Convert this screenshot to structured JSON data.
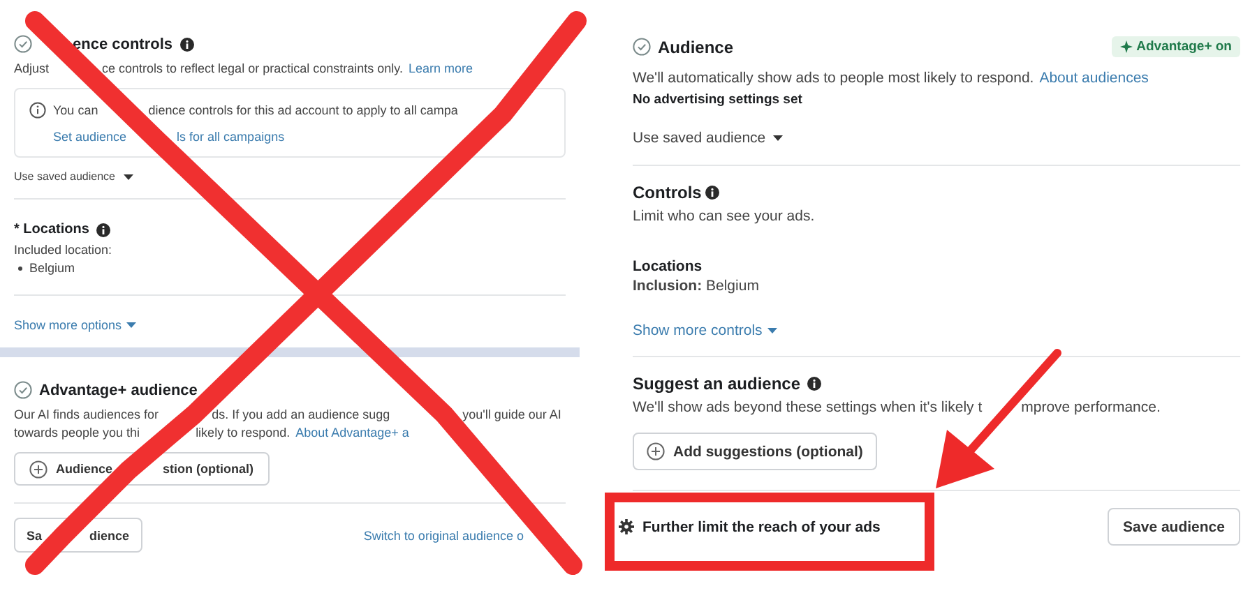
{
  "old_panel": {
    "audience_controls": {
      "title": "ence controls",
      "description": [
        "Adjust",
        "ce controls to reflect legal or practical constraints only."
      ],
      "link": "Learn more",
      "notice": {
        "text": [
          "You can",
          "dience controls for this ad account to apply to all campa"
        ],
        "link": [
          "Set audience",
          "ls for all campaigns"
        ]
      },
      "saved_audience": "Use saved audience"
    },
    "locations": {
      "label": "* Locations",
      "sublabel": "Included location:",
      "items": [
        "Belgium"
      ]
    },
    "show_more": "Show more options",
    "advantage": {
      "title": "Advantage+ audience",
      "lines": [
        [
          "Our AI finds audiences for",
          "ds. If you add an audience sugg",
          "you'll guide our AI"
        ],
        [
          "towards people you thi",
          "likely to respond."
        ]
      ],
      "link": "About Advantage+ a",
      "button": [
        "Audience",
        "stion (optional)"
      ]
    },
    "footer": {
      "save_button": [
        "Sa",
        "dience"
      ],
      "link": "Switch to original audience o"
    }
  },
  "new_panel": {
    "audience": {
      "title": "Audience",
      "badge": "Advantage+ on",
      "description": "We'll automatically show ads to people most likely to respond.",
      "link": "About audiences",
      "note": "No advertising settings set",
      "saved_audience": "Use saved audience"
    },
    "controls": {
      "title": "Controls",
      "description": "Limit who can see your ads.",
      "locations_label": "Locations",
      "inclusion": "**Inclusion:** Belgium",
      "show_more": "Show more controls"
    },
    "suggest": {
      "title": "Suggest an audience",
      "description": [
        "We'll show ads beyond these settings when it's likely t",
        "mprove performance."
      ],
      "button": "Add suggestions (optional)"
    },
    "footer": {
      "further_limit": "Further limit the reach of your ads",
      "save_button": "Save audience"
    }
  }
}
